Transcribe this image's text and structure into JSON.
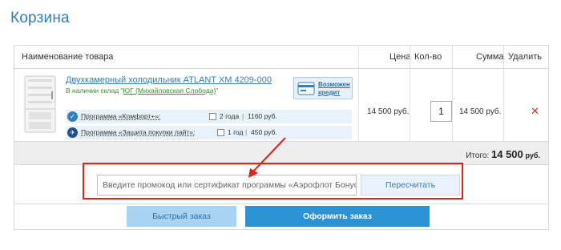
{
  "page": {
    "title": "Корзина"
  },
  "table": {
    "headers": {
      "name": "Наименование товара",
      "price": "Цена",
      "qty": "Кол-во",
      "sum": "Сумма",
      "remove": "Удалить"
    }
  },
  "product": {
    "name": "Двухкамерный холодильник ATLANT ХМ 4209-000",
    "stock_prefix": "В наличии склад \"",
    "stock_link": "ЮГ (Михайловская Слобода)",
    "stock_suffix": "\"",
    "credit_line1": "Возможен",
    "credit_line2": "кредит",
    "price": "14 500 руб.",
    "qty": "1",
    "sum": "14 500 руб.",
    "remove_icon": "✕",
    "warranties": [
      {
        "icon": "comfort-program-icon",
        "label": "Программа «Комфорт+»:",
        "option": "2 года",
        "sep": "|",
        "price": "1160 руб."
      },
      {
        "icon": "protection-program-icon",
        "label": "Программа «Защита покупки лайт»:",
        "option": "1 год",
        "sep": "|",
        "price": "450 руб."
      }
    ]
  },
  "total": {
    "label": "Итого:",
    "value": "14 500",
    "unit": "руб."
  },
  "promo": {
    "placeholder": "Введите промокод или сертификат программы «Аэрофлот Бонус»",
    "recalc": "Пересчитать"
  },
  "buttons": {
    "quick": "Быстрый заказ",
    "order": "Оформить заказ"
  },
  "colors": {
    "accent": "#2f7fc1",
    "order_button": "#2b92d6",
    "quick_button": "#a9d3f3",
    "highlight": "#e2231a",
    "in_stock": "#3a8f2e",
    "delete": "#d9302c"
  }
}
